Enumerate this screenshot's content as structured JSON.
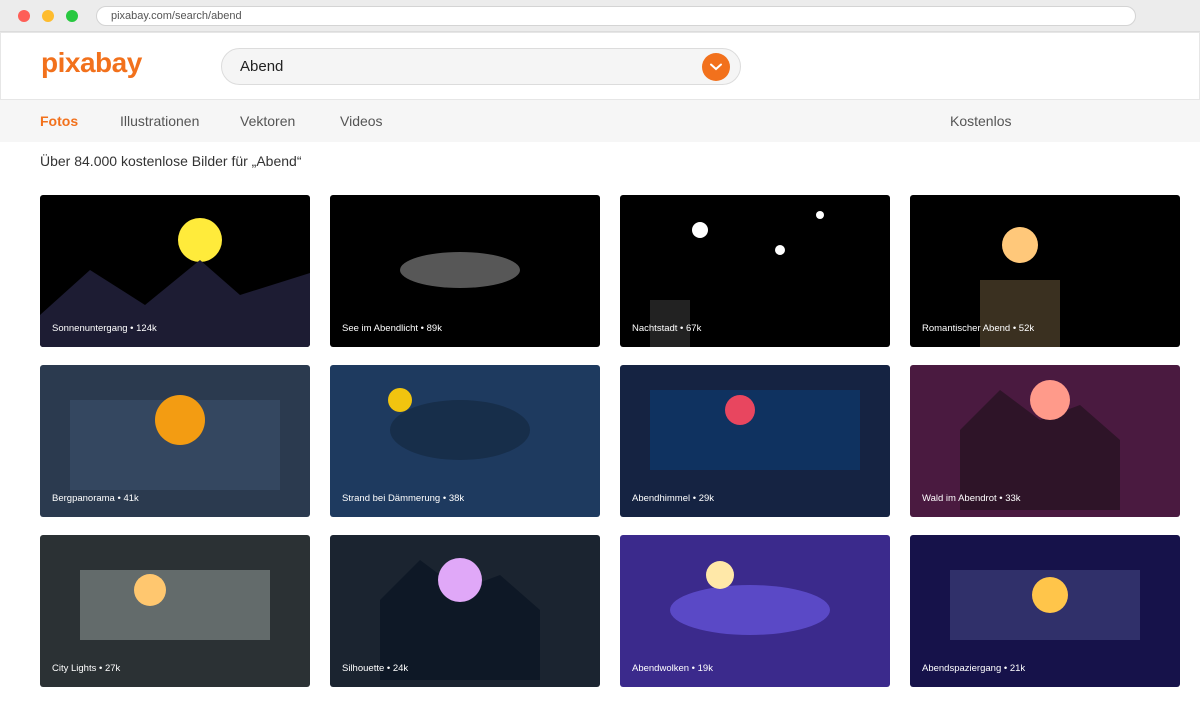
{
  "browser": {
    "url": "pixabay.com/search/abend"
  },
  "header": {
    "logo": "pixabay",
    "search_value": "Abend"
  },
  "nav": {
    "tabs": [
      {
        "label": "Fotos",
        "active": true
      },
      {
        "label": "Illustrationen",
        "active": false
      },
      {
        "label": "Vektoren",
        "active": false
      },
      {
        "label": "Videos",
        "active": false
      }
    ],
    "right_link": "Kostenlos"
  },
  "results": {
    "summary": "Über 84.000 kostenlose Bilder für „Abend“"
  },
  "colors": {
    "brand": "#f2711c"
  },
  "cards": [
    {
      "label": "Sonnenuntergang • 124k",
      "bg": "#000000",
      "scene": "mountain-sun",
      "accent": "#ffeb3b",
      "shape": "#1d1c33"
    },
    {
      "label": "See im Abendlicht • 89k",
      "bg": "#000000",
      "scene": "lake",
      "accent": "#ffffff",
      "shape": "#575757"
    },
    {
      "label": "Nachtstadt • 67k",
      "bg": "#000000",
      "scene": "stars",
      "accent": "#ffffff",
      "shape": "#222222"
    },
    {
      "label": "Romantischer Abend • 52k",
      "bg": "#000000",
      "scene": "tower-sun",
      "accent": "#ffc87a",
      "shape": "#3a3020"
    },
    {
      "label": "Bergpanorama • 41k",
      "bg": "#2b3a4f",
      "scene": "rect-sun",
      "accent": "#f39c12",
      "shape": "#344760"
    },
    {
      "label": "Strand bei Dämmerung • 38k",
      "bg": "#1e3a5f",
      "scene": "oval-sun",
      "accent": "#f1c40f",
      "shape": "#172e4a"
    },
    {
      "label": "Abendhimmel • 29k",
      "bg": "#152342",
      "scene": "rect-sun",
      "accent": "#e8465f",
      "shape": "#0f3260"
    },
    {
      "label": "Wald im Abendrot • 33k",
      "bg": "#4a1a40",
      "scene": "mountain2-sun",
      "accent": "#ff9a8a",
      "shape": "#2e1428"
    },
    {
      "label": "City Lights • 27k",
      "bg": "#2b3134",
      "scene": "rect-sun",
      "accent": "#ffc76f",
      "shape": "#636b6b"
    },
    {
      "label": "Silhouette • 24k",
      "bg": "#1b2430",
      "scene": "mountain2-sun",
      "accent": "#e0a8f8",
      "shape": "#0e1826"
    },
    {
      "label": "Abendwolken • 19k",
      "bg": "#3b2a8c",
      "scene": "oval-sun",
      "accent": "#ffe8a8",
      "shape": "#5a49c6"
    },
    {
      "label": "Abendspaziergang • 21k",
      "bg": "#16124a",
      "scene": "rect-sun",
      "accent": "#ffc54a",
      "shape": "#30306a"
    }
  ]
}
